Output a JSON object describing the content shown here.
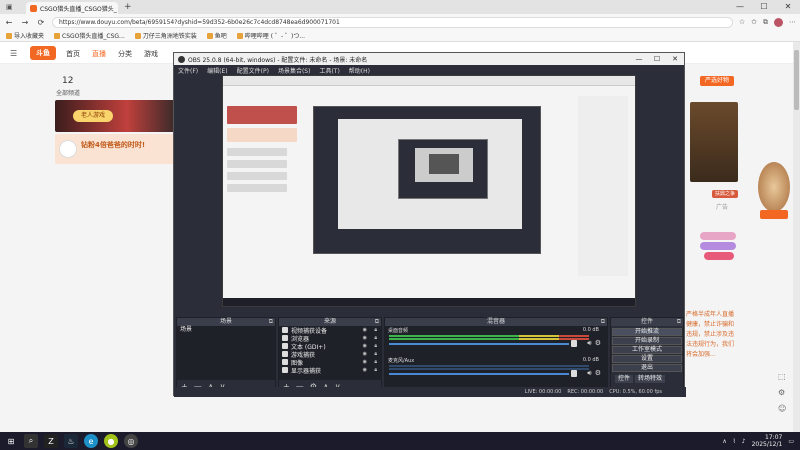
{
  "browser": {
    "tab_title": "CSGO猎头直播_CSGO猎头_",
    "tab_close": "×",
    "new_tab": "+",
    "url": "https://www.douyu.com/beta/6959154?dyshid=59d352-6b0e26c7c4dcd8748ea6d900071701",
    "window_controls": {
      "minimize": "—",
      "maximize": "☐",
      "close": "✕"
    },
    "nav": {
      "back": "←",
      "forward": "→",
      "refresh": "⟳"
    },
    "bookmarks": [
      {
        "label": "导入收藏夹"
      },
      {
        "label": "CSGO猎头直播_CSG..."
      },
      {
        "label": "刀仔三角洲地铁实装"
      },
      {
        "label": "鱼吧"
      },
      {
        "label": "哔哩哔哩 ( ゜- ゜)つ..."
      }
    ]
  },
  "douyu": {
    "logo": "斗鱼",
    "nav": [
      {
        "label": "首页",
        "active": false
      },
      {
        "label": "直播",
        "active": true
      },
      {
        "label": "分类",
        "active": false
      },
      {
        "label": "游戏",
        "active": false
      }
    ],
    "stats": {
      "level": "12",
      "level_label": "全部频道"
    },
    "banner_button": "老人游戏",
    "promo_text": "钻粉4倍爸爸的时时!",
    "right_button": "严选好物",
    "game_label": "扶鼎之争",
    "ad_label": "广告",
    "chat_text": "严格半成年人直播健康，禁止诈骗和违规，禁止涉及违法违规行为，我们将会加强..."
  },
  "obs": {
    "title": "OBS 25.0.8 (64-bit, windows) - 配置文件: 未命名 - 场景: 未命名",
    "menu": [
      "文件(F)",
      "编辑(E)",
      "配置文件(P)",
      "场景集合(S)",
      "工具(T)",
      "帮助(H)"
    ],
    "docks": {
      "scenes": {
        "title": "场景",
        "items": [
          "场景"
        ]
      },
      "sources": {
        "title": "来源",
        "items": [
          {
            "label": "视频捕获设备",
            "icon": "camera-icon"
          },
          {
            "label": "浏览器",
            "icon": "globe-icon"
          },
          {
            "label": "文本 (GDI+)",
            "icon": "text-icon"
          },
          {
            "label": "游戏捕获",
            "icon": "gamepad-icon"
          },
          {
            "label": "图像",
            "icon": "image-icon"
          },
          {
            "label": "显示器捕获",
            "icon": "monitor-icon"
          }
        ]
      },
      "mixer": {
        "title": "混音器",
        "channels": [
          {
            "name": "桌面音频",
            "db": "0.0 dB",
            "level": 0.65
          },
          {
            "name": "麦克风/Aux",
            "db": "0.0 dB",
            "level": 0.0
          }
        ]
      },
      "controls": {
        "title": "控件",
        "buttons": [
          "开始推流",
          "开始录制",
          "工作室模式",
          "设置",
          "退出"
        ],
        "tabs": [
          "控件",
          "转场特效"
        ]
      }
    },
    "status": {
      "live": "LIVE: 00:00:00",
      "rec": "REC: 00:00:00",
      "cpu": "CPU: 0.5%, 60.00 fps"
    },
    "foot_buttons": {
      "add": "+",
      "remove": "—",
      "up": "∧",
      "down": "∨",
      "settings": "⚙"
    }
  },
  "taskbar": {
    "time": "17:07",
    "date": "2025/12/1"
  }
}
